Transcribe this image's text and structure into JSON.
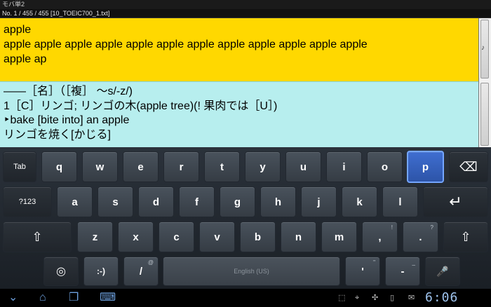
{
  "app": {
    "title": "モバ単2",
    "record_info": "No. 1 / 455 / 455 [10_TOEIC700_1.txt]"
  },
  "entry": {
    "headword": "apple",
    "line2": "apple apple apple apple apple apple apple apple apple apple apple apple",
    "line3": "apple ap",
    "audio_icon": "♪"
  },
  "definition": {
    "line1": "――［名］（［複］ ～s/-z/)",
    "line2": "1［C］リンゴ; リンゴの木(apple tree)(! 果肉では［U］)",
    "line3": "‣bake [bite into] an apple",
    "line4": "リンゴを焼く[かじる]"
  },
  "keyboard": {
    "row1": [
      "Tab",
      "q",
      "w",
      "e",
      "r",
      "t",
      "y",
      "u",
      "i",
      "o",
      "p",
      "⌫"
    ],
    "row2": [
      "?123",
      "a",
      "s",
      "d",
      "f",
      "g",
      "h",
      "j",
      "k",
      "l",
      "↵"
    ],
    "row3": [
      "⇧",
      "z",
      "x",
      "c",
      "v",
      "b",
      "n",
      "m",
      ",",
      ".",
      "⇧"
    ],
    "row3_hints": {
      "comma": "!",
      "period": "?"
    },
    "row4": {
      "settings": "◎",
      "smiley": ":-)",
      "slash": "/",
      "slash_hint": "@",
      "space": "English (US)",
      "apostrophe": "'",
      "apostrophe_hint": "\"",
      "dash": "-",
      "dash_hint": "_",
      "mic": "🎤"
    },
    "pressed_key": "p"
  },
  "navbar": {
    "back_icon": "⌄",
    "home_icon": "⌂",
    "recent_icon": "❐",
    "keyboard_icon": "⌨",
    "clock": "6:06",
    "status_icons": [
      "⬚",
      "⌖",
      "✣",
      "▯",
      "✉"
    ]
  },
  "colors": {
    "entry_bg": "#ffd800",
    "definition_bg": "#b7eeee",
    "pressed_key": "#3f6ed0"
  }
}
